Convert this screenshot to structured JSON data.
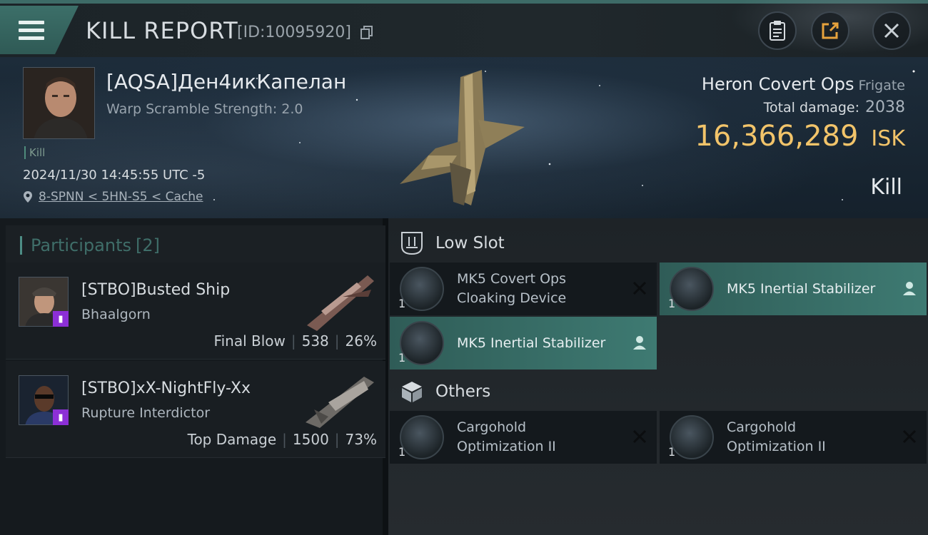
{
  "header": {
    "title": "KILL REPORT",
    "report_id": "[ID:10095920]"
  },
  "victim": {
    "name": "[AQSA]Ден4икКапелан",
    "warp_scramble": "Warp Scramble Strength: 2.0",
    "kill_tag": "Kill",
    "timestamp": "2024/11/30 14:45:55 UTC -5",
    "location": "8-SPNN < 5HN-S5 < Cache",
    "ship_name": "Heron Covert Ops",
    "ship_class": "Frigate",
    "total_damage_label": "Total damage:",
    "total_damage": "2038",
    "isk_value": "16,366,289",
    "isk_unit": "ISK",
    "result": "Kill"
  },
  "participants": {
    "header_label": "Participants",
    "count": "[2]",
    "rows": [
      {
        "name": "[STBO]Busted Ship",
        "ship": "Bhaalgorn",
        "role": "Final Blow",
        "damage": "538",
        "percent": "26%"
      },
      {
        "name": "[STBO]xX-NightFly-Xx",
        "ship": "Rupture Interdictor",
        "role": "Top Damage",
        "damage": "1500",
        "percent": "73%"
      }
    ]
  },
  "fitting": {
    "low_slot_label": "Low Slot",
    "others_label": "Others",
    "low_slots": [
      {
        "line1": "MK5 Covert Ops",
        "line2": "Cloaking Device",
        "qty": "1",
        "status": "destroyed"
      },
      {
        "line1": "MK5 Inertial Stabilizer",
        "line2": "",
        "qty": "1",
        "status": "dropped"
      },
      {
        "line1": "MK5 Inertial Stabilizer",
        "line2": "",
        "qty": "1",
        "status": "dropped"
      }
    ],
    "others": [
      {
        "line1": "Cargohold",
        "line2": "Optimization II",
        "qty": "1",
        "status": "destroyed"
      },
      {
        "line1": "Cargohold",
        "line2": "Optimization II",
        "qty": "1",
        "status": "destroyed"
      }
    ]
  },
  "colors": {
    "accent_teal": "#3e7a72",
    "isk_gold": "#f2c46a",
    "drone_badge": "#8c2fd6"
  },
  "icons": [
    "menu-icon",
    "copy-icon",
    "clipboard-icon",
    "share-icon",
    "close-icon",
    "location-pin-icon",
    "low-slot-icon",
    "cargo-box-icon",
    "destroyed-x-icon",
    "person-icon"
  ]
}
